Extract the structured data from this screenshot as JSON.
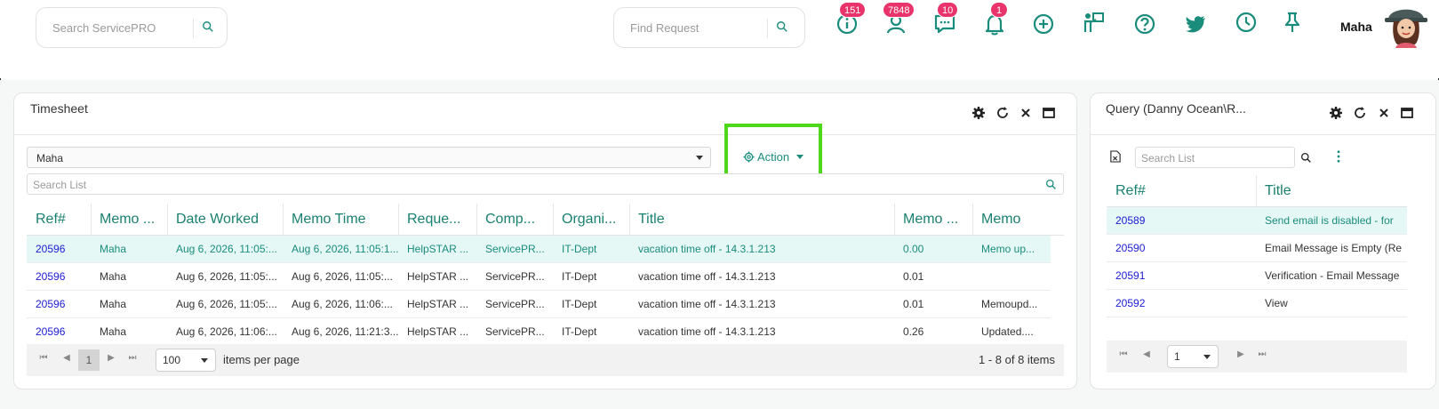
{
  "header": {
    "search_placeholder": "Search ServicePRO",
    "find_placeholder": "Find Request",
    "badges": {
      "info": "151",
      "users": "7848",
      "chat": "10",
      "bell": "1"
    },
    "username": "Maha"
  },
  "timesheet": {
    "title": "Timesheet",
    "user_select": "Maha",
    "action_label": "Action",
    "search_placeholder": "Search List",
    "columns": [
      "Ref#",
      "Memo ...",
      "Date Worked",
      "Memo Time",
      "Reque...",
      "Comp...",
      "Organi...",
      "Title",
      "Memo ...",
      "Memo"
    ],
    "rows": [
      [
        "20596",
        "Maha",
        "Aug 6, 2026, 11:05:...",
        "Aug 6, 2026, 11:05:1...",
        "HelpSTAR ...",
        "ServicePR...",
        "IT-Dept",
        "vacation time off - 14.3.1.213",
        "0.00",
        "Memo up..."
      ],
      [
        "20596",
        "Maha",
        "Aug 6, 2026, 11:05:...",
        "Aug 6, 2026, 11:05:...",
        "HelpSTAR ...",
        "ServicePR...",
        "IT-Dept",
        "vacation time off - 14.3.1.213",
        "0.01",
        ""
      ],
      [
        "20596",
        "Maha",
        "Aug 6, 2026, 11:05:...",
        "Aug 6, 2026, 11:06:...",
        "HelpSTAR ...",
        "ServicePR...",
        "IT-Dept",
        "vacation time off - 14.3.1.213",
        "0.01",
        "Memoupd..."
      ],
      [
        "20596",
        "Maha",
        "Aug 6, 2026, 11:06:...",
        "Aug 6, 2026, 11:21:3...",
        "HelpSTAR ...",
        "ServicePR...",
        "IT-Dept",
        "vacation time off - 14.3.1.213",
        "0.26",
        "Updated...."
      ]
    ],
    "pager": {
      "page": "1",
      "page_size": "100",
      "items_per_page": "items per page",
      "summary": "1 - 8 of 8 items"
    }
  },
  "query": {
    "title": "Query (Danny Ocean\\R...",
    "search_placeholder": "Search List",
    "columns": [
      "Ref#",
      "Title"
    ],
    "rows": [
      [
        "20589",
        "Send email is disabled - for"
      ],
      [
        "20590",
        "Email Message is Empty (Re"
      ],
      [
        "20591",
        "Verification - Email Message"
      ],
      [
        "20592",
        "View"
      ]
    ],
    "pager": {
      "page": "1"
    }
  },
  "colors": {
    "accent": "#1a8c7c",
    "badge": "#e8336b",
    "highlight_box": "#4ed81c",
    "selected_row": "#e5f8f5",
    "link": "#1a1ad6"
  }
}
